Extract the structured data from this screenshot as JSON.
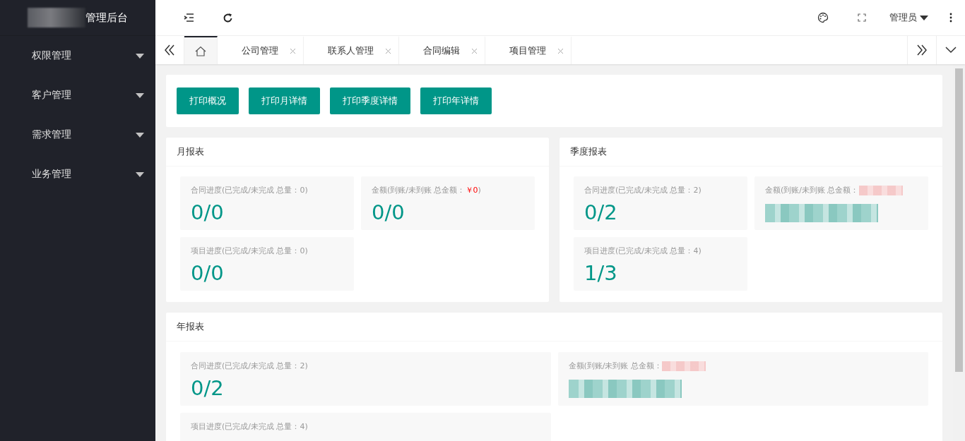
{
  "sidebar": {
    "title": "管理后台",
    "items": [
      {
        "label": "权限管理",
        "expanded": false
      },
      {
        "label": "客户管理",
        "expanded": false
      },
      {
        "label": "需求管理",
        "expanded": false
      },
      {
        "label": "业务管理",
        "expanded": false
      }
    ]
  },
  "header": {
    "user": "管理员"
  },
  "tabs": [
    {
      "kind": "home",
      "selected": true
    },
    {
      "kind": "page",
      "label": "公司管理",
      "selected": false
    },
    {
      "kind": "page",
      "label": "联系人管理",
      "selected": false
    },
    {
      "kind": "page",
      "label": "合同编辑",
      "selected": false
    },
    {
      "kind": "page",
      "label": "项目管理",
      "selected": false
    }
  ],
  "print_buttons": [
    "打印概况",
    "打印月详情",
    "打印季度详情",
    "打印年详情"
  ],
  "reports": [
    {
      "title": "月报表",
      "wide": false,
      "stats": [
        {
          "label": "合同进度(已完成/未完成 总量：0)",
          "value": "0/0",
          "redacted": false
        },
        {
          "label": "金额(到账/未到账 总金额：",
          "amount": "￥0",
          "suffix": ")",
          "value": "0/0",
          "redacted": false
        },
        {
          "label": "项目进度(已完成/未完成 总量：0)",
          "value": "0/0",
          "redacted": false
        }
      ]
    },
    {
      "title": "季度报表",
      "wide": false,
      "stats": [
        {
          "label": "合同进度(已完成/未完成 总量：2)",
          "value": "0/2",
          "redacted": false
        },
        {
          "label": "金额(到账/未到账 总金额：",
          "redacted": true
        },
        {
          "label": "项目进度(已完成/未完成 总量：4)",
          "value": "1/3",
          "redacted": false
        }
      ]
    },
    {
      "title": "年报表",
      "wide": true,
      "stats": [
        {
          "label": "合同进度(已完成/未完成 总量：2)",
          "value": "0/2",
          "redacted": false
        },
        {
          "label": "金额(到账/未到账 总金额：",
          "redacted": true
        },
        {
          "label": "项目进度(已完成/未完成 总量：4)",
          "redacted": false
        }
      ]
    }
  ]
}
